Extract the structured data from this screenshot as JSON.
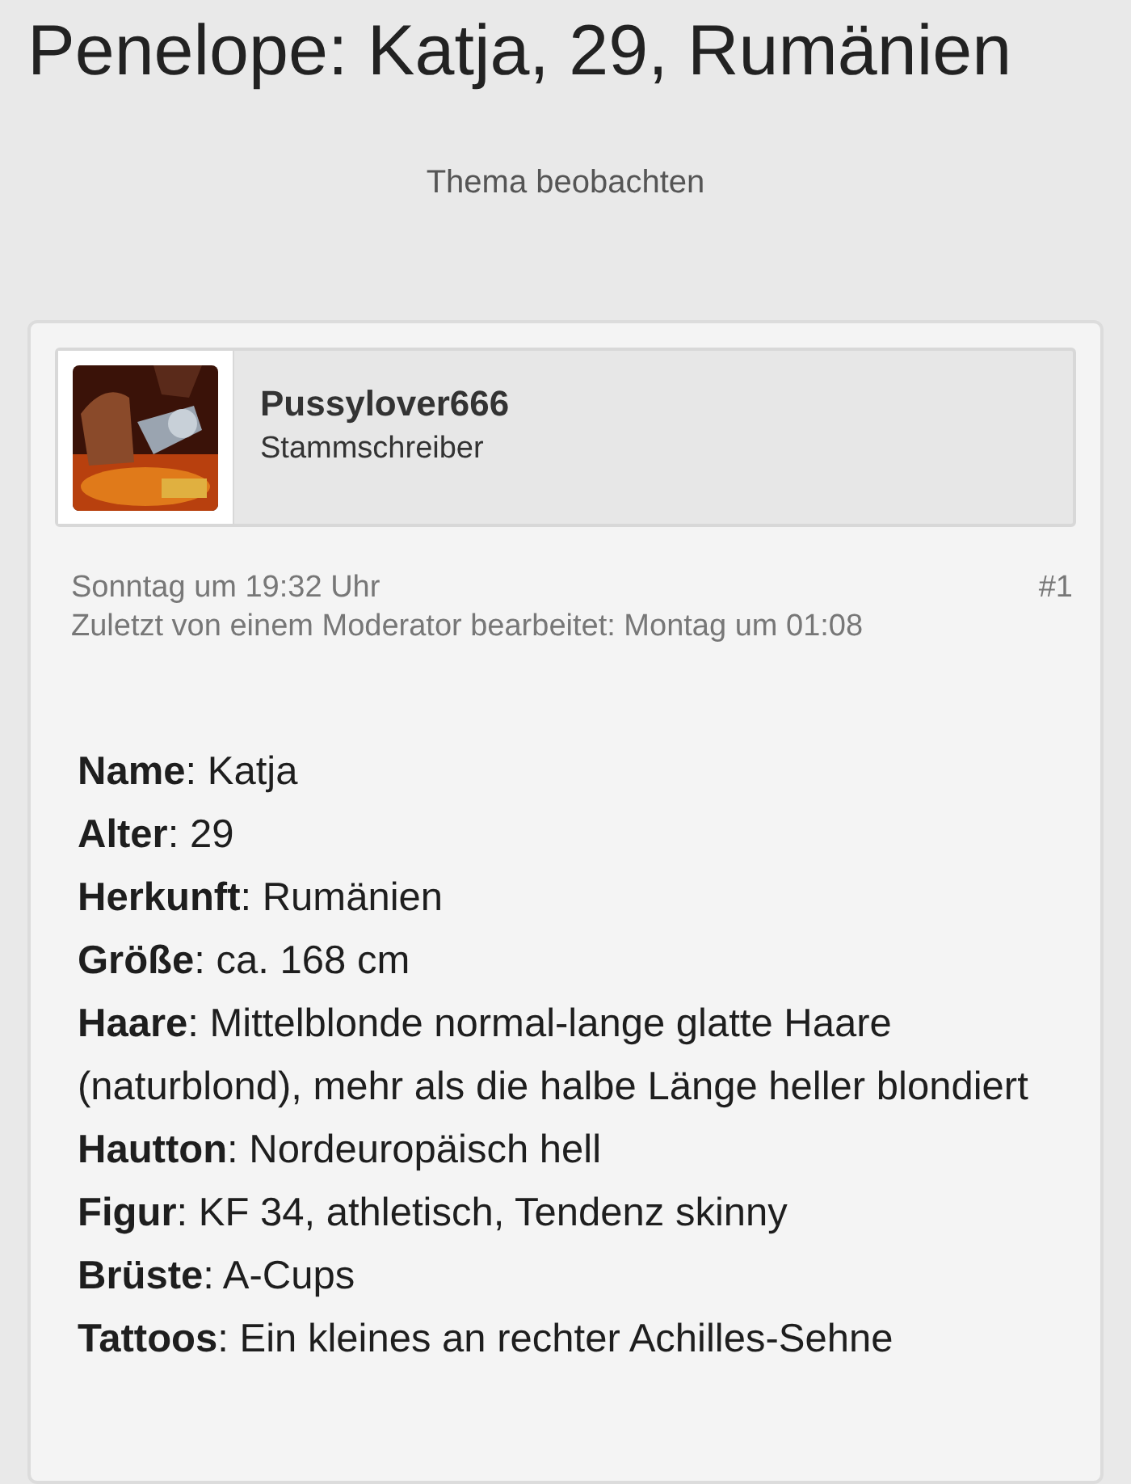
{
  "thread": {
    "title": "Penelope: Katja, 29, Rumänien",
    "watch_link": "Thema beobachten"
  },
  "post": {
    "username": "Pussylover666",
    "user_title": "Stammschreiber",
    "date": "Sonntag um 19:32 Uhr",
    "number": "#1",
    "edited": "Zuletzt von einem Moderator bearbeitet: Montag um 01:08",
    "lines": [
      "**Name**: Katja",
      "**Alter**: 29",
      "**Herkunft**: Rumänien",
      "**Größe**: ca. 168 cm",
      "**Haare**: Mittelblonde normal-lange glatte Haare (naturblond), mehr als die halbe Länge heller blondiert",
      "**Hautton**: Nordeuropäisch hell",
      "**Figur**: KF 34, athletisch, Tendenz skinny",
      "**Brüste**: A-Cups",
      "**Tattoos**: Ein kleines an rechter Achilles-Sehne"
    ]
  }
}
